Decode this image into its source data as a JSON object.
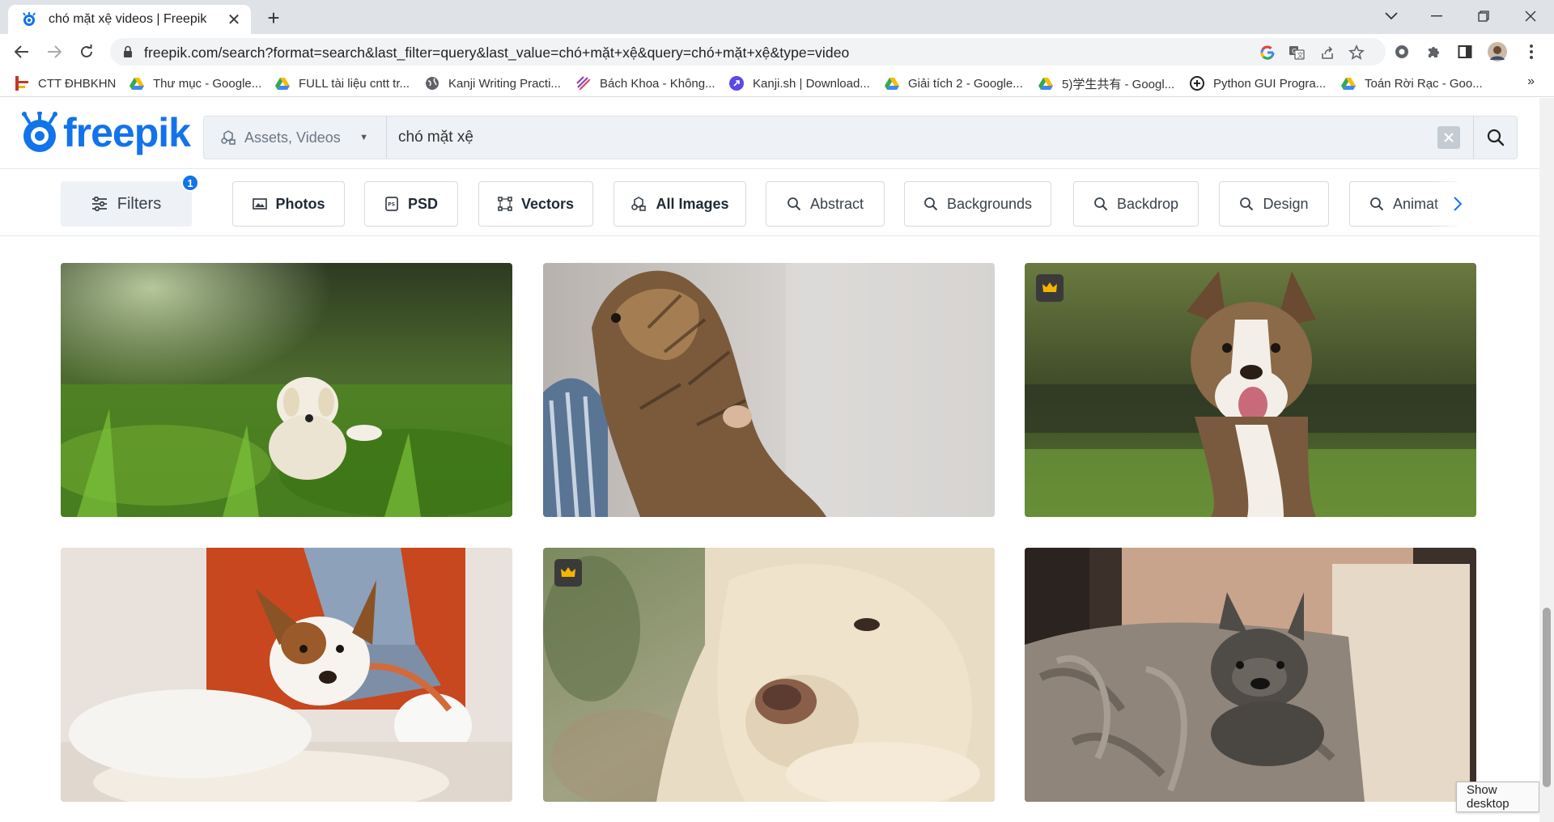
{
  "browser": {
    "tab_title": "chó mặt xệ videos | Freepik",
    "url": "freepik.com/search?format=search&last_filter=query&last_value=chó+mặt+xệ&query=chó+mặt+xệ&type=video",
    "bookmarks": [
      {
        "label": "CTT ĐHBKHN",
        "icon": "ctt-icon"
      },
      {
        "label": "Thư mục - Google...",
        "icon": "google-drive-icon"
      },
      {
        "label": "FULL tài liệu cntt tr...",
        "icon": "google-drive-icon"
      },
      {
        "label": "Kanji Writing Practi...",
        "icon": "globe-icon"
      },
      {
        "label": "Bách Khoa - Không...",
        "icon": "bachkhoa-icon"
      },
      {
        "label": "Kanji.sh | Download...",
        "icon": "kanji-sh-icon"
      },
      {
        "label": "Giải tích 2 - Google...",
        "icon": "google-drive-icon"
      },
      {
        "label": "5)学生共有 - Googl...",
        "icon": "google-drive-icon"
      },
      {
        "label": "Python GUI Progra...",
        "icon": "python-icon"
      },
      {
        "label": "Toán Rời Rạc - Goo...",
        "icon": "google-drive-icon"
      }
    ],
    "bookmarks_more": "»"
  },
  "site": {
    "logo_text": "freepik",
    "brand_color": "#1273eb",
    "search": {
      "asset_type": "Assets, Videos",
      "query": "chó mặt xệ"
    },
    "filters": {
      "label": "Filters",
      "badge_count": "1"
    },
    "chips": [
      {
        "label": "Photos",
        "icon": "photo-icon",
        "bold": true
      },
      {
        "label": "PSD",
        "icon": "psd-icon",
        "bold": true
      },
      {
        "label": "Vectors",
        "icon": "vector-icon",
        "bold": true
      },
      {
        "label": "All Images",
        "icon": "all-images-icon",
        "bold": true
      },
      {
        "label": "Abstract",
        "icon": "search-icon",
        "bold": false
      },
      {
        "label": "Backgrounds",
        "icon": "search-icon",
        "bold": false
      },
      {
        "label": "Backdrop",
        "icon": "search-icon",
        "bold": false
      },
      {
        "label": "Design",
        "icon": "search-icon",
        "bold": false
      },
      {
        "label": "Animat",
        "icon": "search-icon",
        "bold": false
      }
    ],
    "results": [
      {
        "subject": "puppy-in-grass",
        "premium": false
      },
      {
        "subject": "yorkshire-terrier",
        "premium": false
      },
      {
        "subject": "smiling-pitbull",
        "premium": true
      },
      {
        "subject": "jack-russell-terrier",
        "premium": false
      },
      {
        "subject": "white-dog-closeup",
        "premium": true
      },
      {
        "subject": "french-bulldog-on-blanket",
        "premium": false
      }
    ]
  },
  "taskbar_tooltip": "Show desktop"
}
